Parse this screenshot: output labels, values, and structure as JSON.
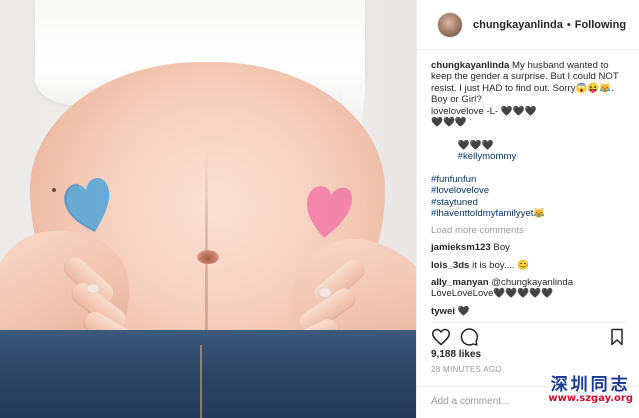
{
  "post": {
    "username": "chungkayanlinda",
    "follow_separator": "•",
    "follow_label": "Following",
    "caption_lines": [
      "My husband wanted to keep the gender a surprise. But I could NOT resist. I just HAD to find out. Sorry😱😝😹.",
      "Boy or Girl?",
      "lovelovelove -L- 🖤🖤🖤",
      "🖤🖤🖤",
      "🖤🖤🖤"
    ],
    "hashtags": [
      "#kellymommy",
      "#funfunfun",
      "#lovelovelove",
      "#staytuned",
      "#ihaventtoldmyfamilyyet😹"
    ],
    "load_more": "Load more comments",
    "comments": [
      {
        "user": "jamieksm123",
        "text": "Boy"
      },
      {
        "user": "lois_3ds",
        "text": "it is boy.... 😊"
      },
      {
        "user": "ally_manyan",
        "text": "@chungkayanlinda LoveLoveLove🖤🖤🖤🖤🖤"
      },
      {
        "user": "tywei",
        "text": "🖤"
      }
    ],
    "likes": "9,188 likes",
    "timestamp": "28 MINUTES AGO",
    "add_comment_placeholder": "Add a comment..."
  },
  "watermark": {
    "cn": "深圳同志",
    "url": "www.szgay.org"
  },
  "colors": {
    "heart_blue": "#5aa6d6",
    "heart_pink": "#f27fa8",
    "link": "#003569",
    "muted": "#999999"
  },
  "icons": {
    "like": "heart-outline-icon",
    "comment": "speech-bubble-icon",
    "save": "bookmark-icon"
  }
}
